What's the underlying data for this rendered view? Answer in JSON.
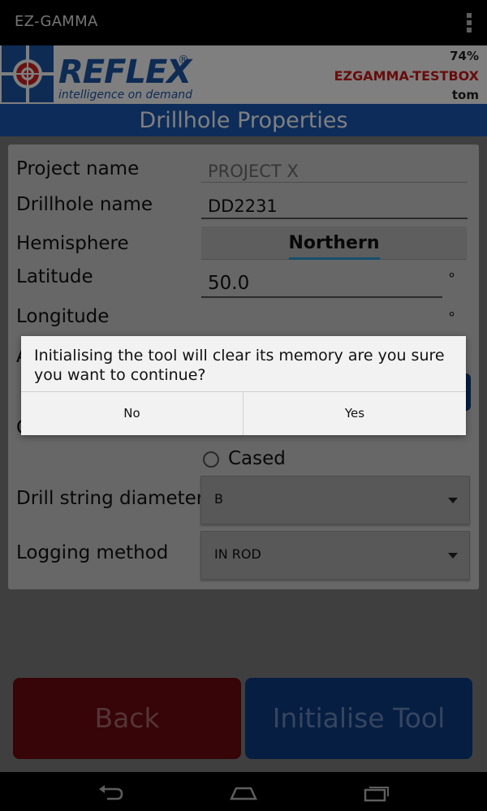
{
  "actionbar": {
    "title": "EZ-GAMMA",
    "menu_icon": "overflow-menu-icon"
  },
  "header": {
    "logo_text": "REFLEX",
    "logo_reg": "®",
    "logo_tagline": "intelligence on demand",
    "battery": "74%",
    "device": "EZGAMMA-TESTBOX",
    "user": "tom"
  },
  "page_title": "Drillhole Properties",
  "form": {
    "project_label": "Project name",
    "project_placeholder": "PROJECT X",
    "drillhole_label": "Drillhole name",
    "drillhole_value": "DD2231",
    "hemisphere_label": "Hemisphere",
    "hemisphere_value": "Northern",
    "latitude_label": "Latitude",
    "latitude_value": "50.0",
    "longitude_label": "Longitude",
    "degree_symbol": "°",
    "partial_label_a": "A",
    "partial_label_c": "C",
    "cased_label": "Cased",
    "drill_string_label": "Drill string diameter",
    "drill_string_value": "B",
    "logging_label": "Logging method",
    "logging_value": "IN ROD"
  },
  "buttons": {
    "back": "Back",
    "initialise": "Initialise Tool"
  },
  "dialog": {
    "message": "Initialising the tool will clear its memory are you sure you want to continue?",
    "no": "No",
    "yes": "Yes"
  },
  "colors": {
    "brand_blue": "#1a59b5",
    "back_red": "#d01818",
    "device_red": "#d01818"
  }
}
